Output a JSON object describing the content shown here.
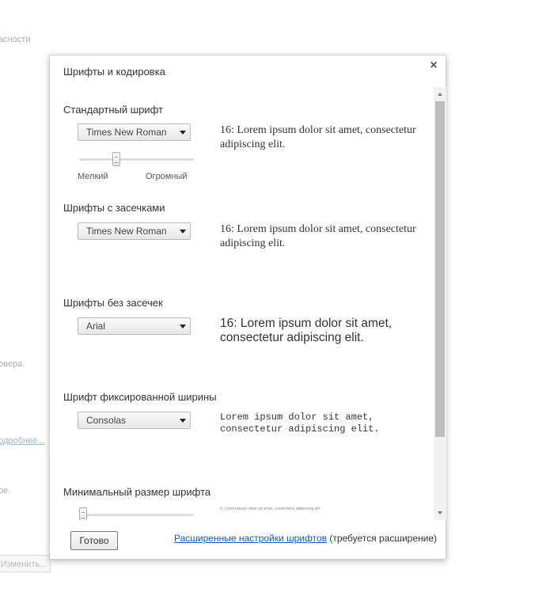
{
  "background": {
    "text_security": "асности",
    "text_server": "овера.",
    "link_more": "одробнее...",
    "text_re": "ре.",
    "button_change": "Изменить..."
  },
  "dialog": {
    "title": "Шрифты и кодировка",
    "close_glyph": "×",
    "standard": {
      "title": "Стандартный шрифт",
      "selected_font": "Times New Roman",
      "preview": "16: Lorem ipsum dolor sit amet, consectetur adipiscing elit.",
      "size_small_label": "Мелкий",
      "size_huge_label": "Огромный",
      "size_level": 0.31
    },
    "serif": {
      "title": "Шрифты с засечками",
      "selected_font": "Times New Roman",
      "preview": "16: Lorem ipsum dolor sit amet, consectetur adipiscing elit."
    },
    "sans_serif": {
      "title": "Шрифты без засечек",
      "selected_font": "Arial",
      "preview": "16: Lorem ipsum dolor sit amet, consectetur adipiscing elit."
    },
    "fixed": {
      "title": "Шрифт фиксированной ширины",
      "selected_font": "Consolas",
      "preview": "Lorem ipsum dolor sit amet, consectetur adipiscing elit."
    },
    "minimum": {
      "title": "Минимальный размер шрифта",
      "preview": "6: Lorem ipsum dolor sit amet, consectetur adipiscing elit.",
      "size_level": 0.0
    },
    "footer": {
      "done_label": "Готово",
      "advanced_link": "Расширенные настройки шрифтов",
      "advanced_note": " (требуется расширение)"
    }
  },
  "colors": {
    "link": "#1155cc",
    "scrollbar_thumb": "#bcbcbc"
  }
}
